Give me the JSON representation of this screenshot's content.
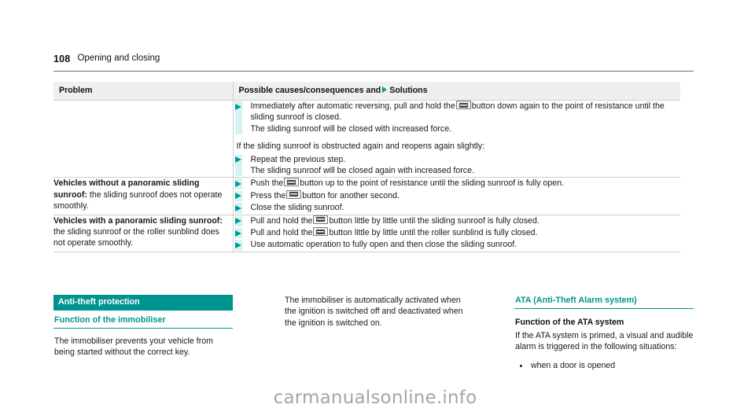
{
  "page": {
    "number": "108",
    "section": "Opening and closing",
    "watermark": "carmanualsonline.info"
  },
  "table": {
    "headers": {
      "problem": "Problem",
      "solutions_prefix": "Possible causes/consequences and",
      "solutions_suffix": "Solutions"
    },
    "rows": [
      {
        "problem": "",
        "blocks": [
          {
            "type": "step",
            "lines": [
              "Immediately after automatic reversing, pull and hold the",
              "button down again to the point of resistance until the sliding sunroof is closed.",
              "The sliding sunroof will be closed with increased force."
            ],
            "icon": "sunroof-button-icon"
          },
          {
            "type": "plain",
            "text": "If the sliding sunroof is obstructed again and reopens again slightly:"
          },
          {
            "type": "step",
            "lines": [
              "Repeat the previous step.",
              "The sliding sunroof will be closed again with increased force."
            ]
          }
        ]
      },
      {
        "problem_bold": "Vehicles without a panoramic sliding sunroof:",
        "problem_rest": " the sliding sunroof does not operate smoothly.",
        "steps": [
          {
            "pre": "Push the",
            "post": "button up to the point of resistance until the sliding sunroof is fully open.",
            "icon": "sunroof-button-icon"
          },
          {
            "pre": "Press the",
            "post": "button for another second.",
            "icon": "sunroof-button-icon"
          },
          {
            "pre": "",
            "post": "Close the sliding sunroof.",
            "icon": ""
          }
        ]
      },
      {
        "problem_bold": "Vehicles with a panoramic sliding sunroof:",
        "problem_rest": " the sliding sunroof or the roller sunblind does not operate smoothly.",
        "steps": [
          {
            "pre": "Pull and hold the",
            "post": "button little by little until the sliding sunroof is fully closed.",
            "icon": "sunroof-button-icon"
          },
          {
            "pre": "Pull and hold the",
            "post": "button little by little until the roller sunblind is fully closed.",
            "icon": "sunroof-button-icon"
          },
          {
            "pre": "",
            "post": "Use automatic operation to fully open and then close the sliding sunroof.",
            "icon": ""
          }
        ]
      }
    ]
  },
  "columns": {
    "left": {
      "section_title": "Anti-theft protection",
      "sub_title": "Function of the immobiliser",
      "body": "The immobiliser prevents your vehicle from being started without the correct key."
    },
    "middle": {
      "body": "The immobiliser is automatically activated when the ignition is switched off and deactivated when the ignition is switched on."
    },
    "right": {
      "sub_title": "ATA (Anti-Theft Alarm system)",
      "body_head": "Function of the ATA system",
      "body": "If the ATA system is primed, a visual and audible alarm is triggered in the following situations:",
      "bullets": [
        "when a door is opened"
      ]
    }
  },
  "colors": {
    "teal": "#009490",
    "teal_triangle": "#009a96",
    "rail_cyan": "#d2f5f4",
    "table_header_bg": "#efefef",
    "rule_gray": "#cfcfcf"
  }
}
